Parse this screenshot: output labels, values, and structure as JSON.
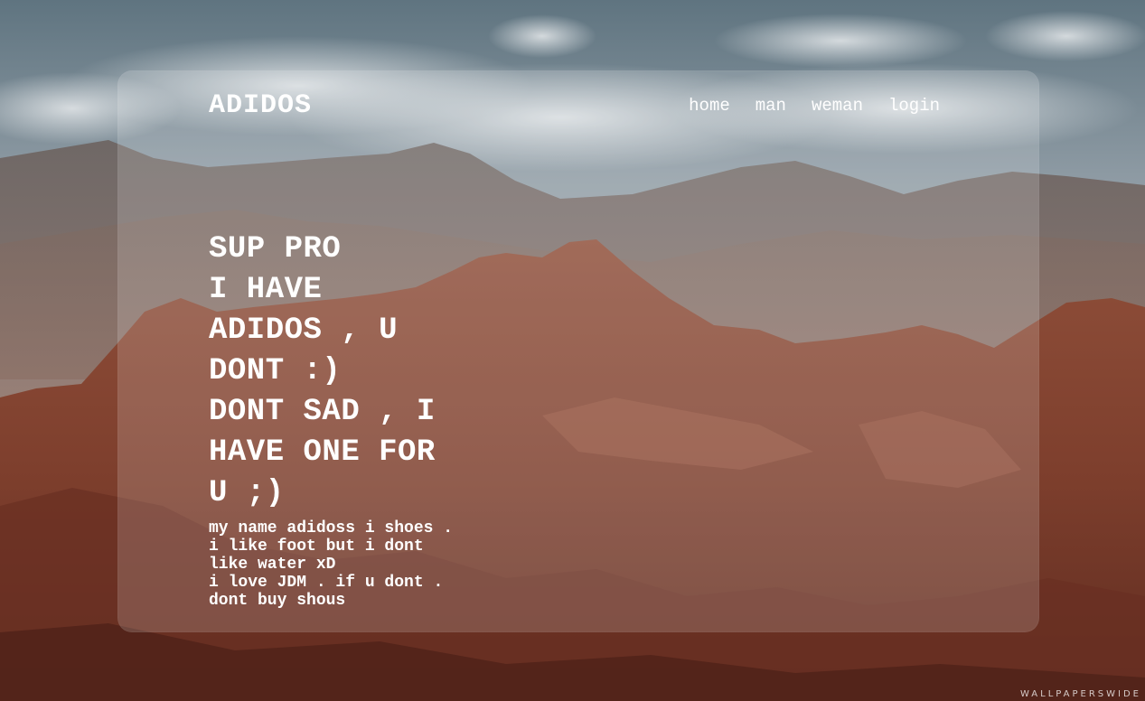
{
  "brand": {
    "name": "ADIDOS"
  },
  "nav": {
    "items": [
      {
        "label": "home"
      },
      {
        "label": "man"
      },
      {
        "label": "weman"
      },
      {
        "label": "login"
      }
    ]
  },
  "hero": {
    "headline_lines": [
      "SUP PRO",
      "I HAVE",
      "ADIDOS , U",
      "DONT :)",
      "DONT SAD , I",
      "HAVE ONE FOR",
      "U ;)"
    ],
    "body_lines": [
      "my name adidoss i shoes .",
      "i like foot but i dont",
      "like water xD",
      "i love JDM . if u dont .",
      "dont buy shous"
    ]
  },
  "background": {
    "watermark": "WALLPAPERSWIDE"
  },
  "colors": {
    "text": "#ffffff",
    "sky": "#7d8f9c",
    "rock": "#8a4a36",
    "card_overlay": "rgba(255,255,255,0.16)"
  }
}
